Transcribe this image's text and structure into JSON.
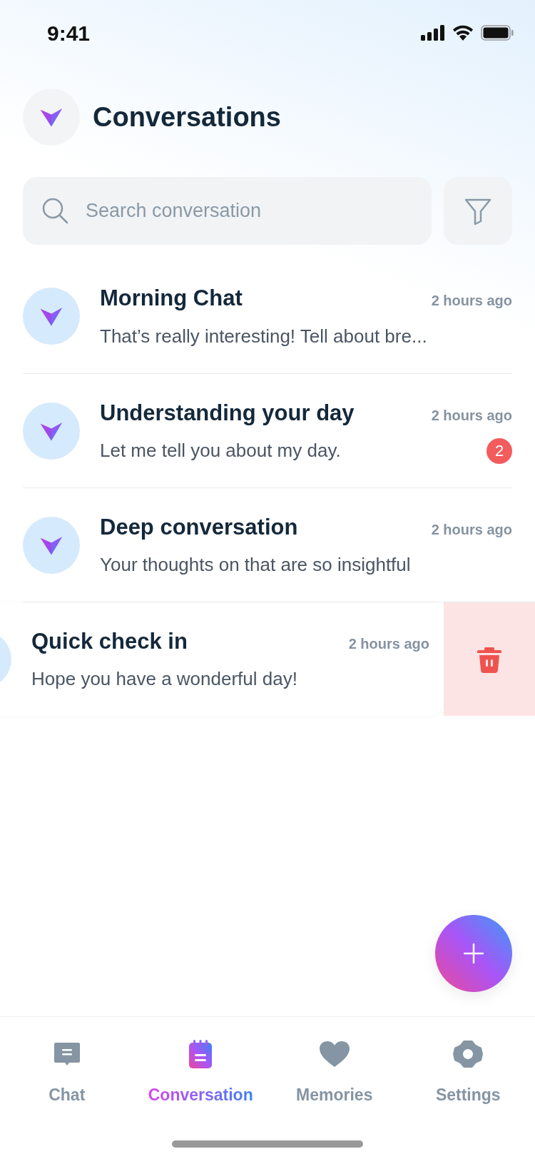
{
  "status_bar": {
    "time": "9:41"
  },
  "header": {
    "title": "Conversations"
  },
  "search": {
    "placeholder": "Search conversation"
  },
  "conversations": [
    {
      "title": "Morning Chat",
      "time": "2 hours ago",
      "preview": "That’s really interesting! Tell about bre...",
      "swiped": false
    },
    {
      "title": "Understanding your day",
      "time": "2 hours ago",
      "preview": "Let me tell you about my day.",
      "unread": "2",
      "swiped": false
    },
    {
      "title": "Deep conversation",
      "time": "2 hours ago",
      "preview": "Your thoughts on that are so insightful",
      "swiped": false
    },
    {
      "title": "Quick check in",
      "time": "2 hours ago",
      "preview": "Hope you have a wonderful day!",
      "swiped": true
    }
  ],
  "tab_bar": [
    {
      "label": "Chat",
      "kind": "chat",
      "selected": false
    },
    {
      "label": "Conversation",
      "kind": "notepad",
      "selected": true
    },
    {
      "label": "Memories",
      "kind": "heart",
      "selected": false
    },
    {
      "label": "Settings",
      "kind": "gear",
      "selected": false
    }
  ]
}
